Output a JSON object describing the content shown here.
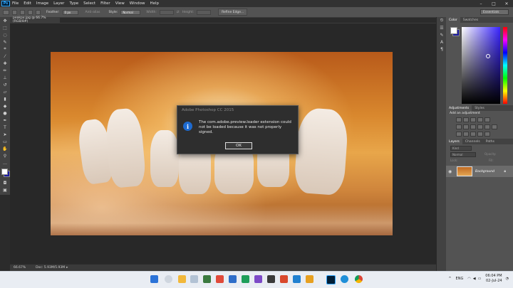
{
  "app": {
    "logo": "Ps",
    "menu": [
      "File",
      "Edit",
      "Image",
      "Layer",
      "Type",
      "Select",
      "Filter",
      "View",
      "Window",
      "Help"
    ],
    "window_controls": [
      "–",
      "□",
      "✕"
    ]
  },
  "options_bar": {
    "feather_label": "Feather:",
    "feather_value": "0 px",
    "antialias_label": "Anti-alias",
    "style_label": "Style:",
    "style_value": "Normal",
    "width_label": "Width:",
    "height_label": "Height:",
    "refine_edge_label": "Refine Edge...",
    "workspace": "Essentials"
  },
  "document": {
    "tab_title": "peakpx.jpg @ 66.7% (RGB/8#)",
    "zoom": "66.67%",
    "doc_size": "Doc: 5.93M/5.93M"
  },
  "dialog": {
    "title": "Adobe Photoshop CC 2015",
    "message": "The com.adobe.preview.loader extension could not be loaded because it was not properly signed.",
    "ok_label": "OK",
    "info_glyph": "i"
  },
  "panels": {
    "color_tabs": [
      "Color",
      "Swatches"
    ],
    "adjust_tabs": [
      "Adjustments",
      "Styles"
    ],
    "add_adjustment": "Add an adjustment",
    "layers_tabs": [
      "Layers",
      "Channels",
      "Paths"
    ],
    "kind_label": "Kind",
    "blend_mode": "Normal",
    "opacity_label": "Opacity:",
    "lock_label": "Lock:",
    "fill_label": "Fill:",
    "layer_name": "Background"
  },
  "taskbar": {
    "language": "ENG",
    "time": "06:04 PM",
    "date": "02-Jul-24"
  }
}
